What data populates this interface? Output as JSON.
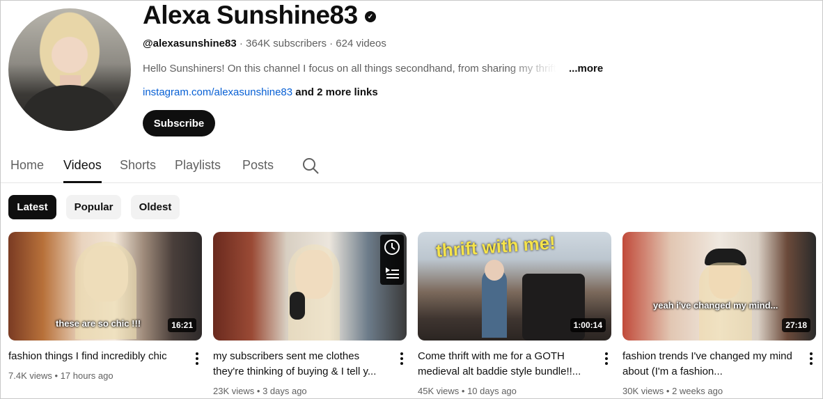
{
  "channel": {
    "name": "Alexa Sunshine83",
    "handle": "@alexasunshine83",
    "subscribers": "364K subscribers",
    "videos_count": "624 videos",
    "separator": "·",
    "description": "Hello Sunshiners! On this channel I focus on all things secondhand, from sharing my thrift",
    "more_label": "...more",
    "link": "instagram.com/alexasunshine83",
    "more_links": "and 2 more links",
    "subscribe_label": "Subscribe"
  },
  "tabs": [
    {
      "label": "Home"
    },
    {
      "label": "Videos"
    },
    {
      "label": "Shorts"
    },
    {
      "label": "Playlists"
    },
    {
      "label": "Posts"
    }
  ],
  "chips": [
    {
      "label": "Latest"
    },
    {
      "label": "Popular"
    },
    {
      "label": "Oldest"
    }
  ],
  "videos": [
    {
      "title": "fashion things I find incredibly chic",
      "views": "7.4K views",
      "age": "17 hours ago",
      "duration": "16:21",
      "caption": "these are so chic !!!"
    },
    {
      "title": "my subscribers sent me clothes they're thinking of buying & I tell y...",
      "views": "23K views",
      "age": "3 days ago",
      "duration": ""
    },
    {
      "title": "Come thrift with me for a GOTH medieval alt baddie style bundle!!...",
      "views": "45K views",
      "age": "10 days ago",
      "duration": "1:00:14",
      "caption": "thrift with me!"
    },
    {
      "title": "fashion trends I've changed my mind about (I'm a fashion...",
      "views": "30K views",
      "age": "2 weeks ago",
      "duration": "27:18",
      "caption": "yeah i've changed my mind..."
    }
  ],
  "stats_separator": "•"
}
